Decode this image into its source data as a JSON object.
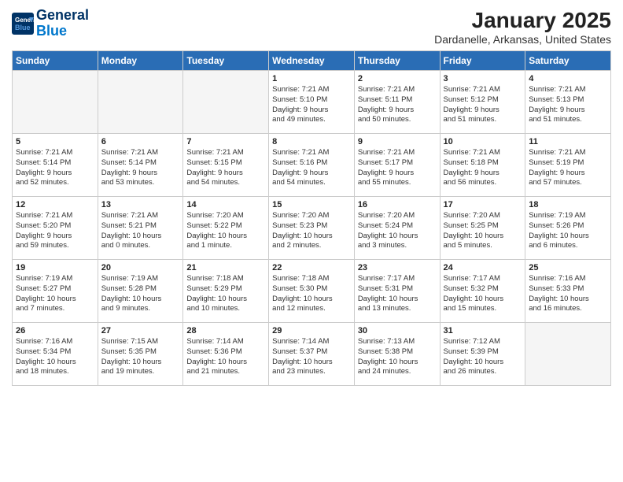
{
  "header": {
    "logo_line1": "General",
    "logo_line2": "Blue",
    "month": "January 2025",
    "location": "Dardanelle, Arkansas, United States"
  },
  "weekdays": [
    "Sunday",
    "Monday",
    "Tuesday",
    "Wednesday",
    "Thursday",
    "Friday",
    "Saturday"
  ],
  "weeks": [
    [
      {
        "day": "",
        "empty": true
      },
      {
        "day": "",
        "empty": true
      },
      {
        "day": "",
        "empty": true
      },
      {
        "day": "1",
        "info": "Sunrise: 7:21 AM\nSunset: 5:10 PM\nDaylight: 9 hours\nand 49 minutes."
      },
      {
        "day": "2",
        "info": "Sunrise: 7:21 AM\nSunset: 5:11 PM\nDaylight: 9 hours\nand 50 minutes."
      },
      {
        "day": "3",
        "info": "Sunrise: 7:21 AM\nSunset: 5:12 PM\nDaylight: 9 hours\nand 51 minutes."
      },
      {
        "day": "4",
        "info": "Sunrise: 7:21 AM\nSunset: 5:13 PM\nDaylight: 9 hours\nand 51 minutes."
      }
    ],
    [
      {
        "day": "5",
        "info": "Sunrise: 7:21 AM\nSunset: 5:14 PM\nDaylight: 9 hours\nand 52 minutes."
      },
      {
        "day": "6",
        "info": "Sunrise: 7:21 AM\nSunset: 5:14 PM\nDaylight: 9 hours\nand 53 minutes."
      },
      {
        "day": "7",
        "info": "Sunrise: 7:21 AM\nSunset: 5:15 PM\nDaylight: 9 hours\nand 54 minutes."
      },
      {
        "day": "8",
        "info": "Sunrise: 7:21 AM\nSunset: 5:16 PM\nDaylight: 9 hours\nand 54 minutes."
      },
      {
        "day": "9",
        "info": "Sunrise: 7:21 AM\nSunset: 5:17 PM\nDaylight: 9 hours\nand 55 minutes."
      },
      {
        "day": "10",
        "info": "Sunrise: 7:21 AM\nSunset: 5:18 PM\nDaylight: 9 hours\nand 56 minutes."
      },
      {
        "day": "11",
        "info": "Sunrise: 7:21 AM\nSunset: 5:19 PM\nDaylight: 9 hours\nand 57 minutes."
      }
    ],
    [
      {
        "day": "12",
        "info": "Sunrise: 7:21 AM\nSunset: 5:20 PM\nDaylight: 9 hours\nand 59 minutes."
      },
      {
        "day": "13",
        "info": "Sunrise: 7:21 AM\nSunset: 5:21 PM\nDaylight: 10 hours\nand 0 minutes."
      },
      {
        "day": "14",
        "info": "Sunrise: 7:20 AM\nSunset: 5:22 PM\nDaylight: 10 hours\nand 1 minute."
      },
      {
        "day": "15",
        "info": "Sunrise: 7:20 AM\nSunset: 5:23 PM\nDaylight: 10 hours\nand 2 minutes."
      },
      {
        "day": "16",
        "info": "Sunrise: 7:20 AM\nSunset: 5:24 PM\nDaylight: 10 hours\nand 3 minutes."
      },
      {
        "day": "17",
        "info": "Sunrise: 7:20 AM\nSunset: 5:25 PM\nDaylight: 10 hours\nand 5 minutes."
      },
      {
        "day": "18",
        "info": "Sunrise: 7:19 AM\nSunset: 5:26 PM\nDaylight: 10 hours\nand 6 minutes."
      }
    ],
    [
      {
        "day": "19",
        "info": "Sunrise: 7:19 AM\nSunset: 5:27 PM\nDaylight: 10 hours\nand 7 minutes."
      },
      {
        "day": "20",
        "info": "Sunrise: 7:19 AM\nSunset: 5:28 PM\nDaylight: 10 hours\nand 9 minutes."
      },
      {
        "day": "21",
        "info": "Sunrise: 7:18 AM\nSunset: 5:29 PM\nDaylight: 10 hours\nand 10 minutes."
      },
      {
        "day": "22",
        "info": "Sunrise: 7:18 AM\nSunset: 5:30 PM\nDaylight: 10 hours\nand 12 minutes."
      },
      {
        "day": "23",
        "info": "Sunrise: 7:17 AM\nSunset: 5:31 PM\nDaylight: 10 hours\nand 13 minutes."
      },
      {
        "day": "24",
        "info": "Sunrise: 7:17 AM\nSunset: 5:32 PM\nDaylight: 10 hours\nand 15 minutes."
      },
      {
        "day": "25",
        "info": "Sunrise: 7:16 AM\nSunset: 5:33 PM\nDaylight: 10 hours\nand 16 minutes."
      }
    ],
    [
      {
        "day": "26",
        "info": "Sunrise: 7:16 AM\nSunset: 5:34 PM\nDaylight: 10 hours\nand 18 minutes."
      },
      {
        "day": "27",
        "info": "Sunrise: 7:15 AM\nSunset: 5:35 PM\nDaylight: 10 hours\nand 19 minutes."
      },
      {
        "day": "28",
        "info": "Sunrise: 7:14 AM\nSunset: 5:36 PM\nDaylight: 10 hours\nand 21 minutes."
      },
      {
        "day": "29",
        "info": "Sunrise: 7:14 AM\nSunset: 5:37 PM\nDaylight: 10 hours\nand 23 minutes."
      },
      {
        "day": "30",
        "info": "Sunrise: 7:13 AM\nSunset: 5:38 PM\nDaylight: 10 hours\nand 24 minutes."
      },
      {
        "day": "31",
        "info": "Sunrise: 7:12 AM\nSunset: 5:39 PM\nDaylight: 10 hours\nand 26 minutes."
      },
      {
        "day": "",
        "empty": true
      }
    ]
  ]
}
